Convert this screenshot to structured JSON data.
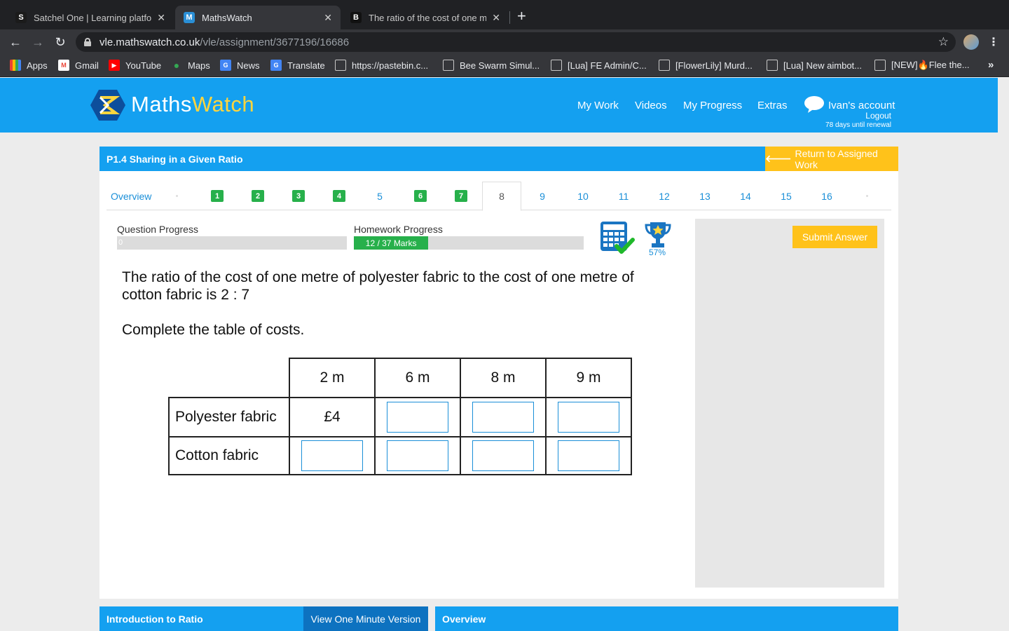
{
  "browser": {
    "tabs": [
      {
        "title": "Satchel One | Learning platform",
        "favicon": "S",
        "color": "#1b1b1b"
      },
      {
        "title": "MathsWatch",
        "favicon": "M",
        "color": "#2a8fd6"
      },
      {
        "title": "The ratio of the cost of one metre",
        "favicon": "B",
        "color": "#1b1b1b"
      }
    ],
    "url_host": "vle.mathswatch.co.uk",
    "url_path": "/vle/assignment/3677196/16686",
    "bookmarks": [
      {
        "label": "Apps",
        "icon": "apps-grid-icon",
        "color": "#4285f4"
      },
      {
        "label": "Gmail",
        "icon": "gmail-icon",
        "color": "#ea4335"
      },
      {
        "label": "YouTube",
        "icon": "youtube-icon",
        "color": "#ff0000"
      },
      {
        "label": "Maps",
        "icon": "maps-icon",
        "color": "#34a853"
      },
      {
        "label": "News",
        "icon": "news-icon",
        "color": "#4285f4"
      },
      {
        "label": "Translate",
        "icon": "translate-icon",
        "color": "#4285f4"
      },
      {
        "label": "https://pastebin.c...",
        "icon": "roblox-icon",
        "color": "#5f6368"
      },
      {
        "label": "Bee Swarm Simul...",
        "icon": "roblox-icon",
        "color": "#5f6368"
      },
      {
        "label": "[Lua] FE Admin/C...",
        "icon": "roblox-icon",
        "color": "#5f6368"
      },
      {
        "label": "[FlowerLily] Murd...",
        "icon": "roblox-icon",
        "color": "#5f6368"
      },
      {
        "label": "[Lua] New aimbot...",
        "icon": "roblox-icon",
        "color": "#5f6368"
      },
      {
        "label": "[NEW]🔥Flee the...",
        "icon": "roblox-icon",
        "color": "#5f6368"
      }
    ],
    "more_bookmarks": "»"
  },
  "site": {
    "logo_maths": "Maths",
    "logo_watch": "Watch",
    "nav": [
      "My Work",
      "Videos",
      "My Progress",
      "Extras"
    ],
    "account": "Ivan's account",
    "logout": "Logout",
    "renewal": "78 days until renewal",
    "brand_color": "#14a0f0",
    "accent_color": "#ffc21a"
  },
  "assignment": {
    "title": "P1.4 Sharing in a Given Ratio",
    "return_label": "Return to Assigned Work",
    "overview_tab": "Overview",
    "questions": [
      {
        "label": "1",
        "done": true
      },
      {
        "label": "2",
        "done": true
      },
      {
        "label": "3",
        "done": true
      },
      {
        "label": "4",
        "done": true
      },
      {
        "label": "5",
        "done": false
      },
      {
        "label": "6",
        "done": true
      },
      {
        "label": "7",
        "done": true
      },
      {
        "label": "8",
        "done": false,
        "active": true
      },
      {
        "label": "9",
        "done": false
      },
      {
        "label": "10",
        "done": false
      },
      {
        "label": "11",
        "done": false
      },
      {
        "label": "12",
        "done": false
      },
      {
        "label": "13",
        "done": false
      },
      {
        "label": "14",
        "done": false
      },
      {
        "label": "15",
        "done": false
      },
      {
        "label": "16",
        "done": false
      }
    ],
    "question_progress_label": "Question Progress",
    "question_progress_value": "0",
    "question_progress_fraction": 0,
    "homework_progress_label": "Homework Progress",
    "homework_progress_text": "12 / 37 Marks",
    "homework_progress_fraction": 0.324,
    "trophy_percent": "57%",
    "submit_label": "Submit Answer"
  },
  "question": {
    "text": "The ratio of the cost of one metre of polyester fabric to the cost of one metre of cotton fabric is 2 : 7",
    "instruction": "Complete the table of costs.",
    "table": {
      "columns": [
        "2 m",
        "6 m",
        "8 m",
        "9 m"
      ],
      "rows": [
        {
          "label": "Polyester fabric",
          "cells": [
            "£4",
            "",
            "",
            ""
          ]
        },
        {
          "label": "Cotton fabric",
          "cells": [
            "",
            "",
            "",
            ""
          ]
        }
      ]
    }
  },
  "footer": {
    "intro_title": "Introduction to Ratio",
    "video_button": "View One Minute Version",
    "overview_title": "Overview"
  }
}
